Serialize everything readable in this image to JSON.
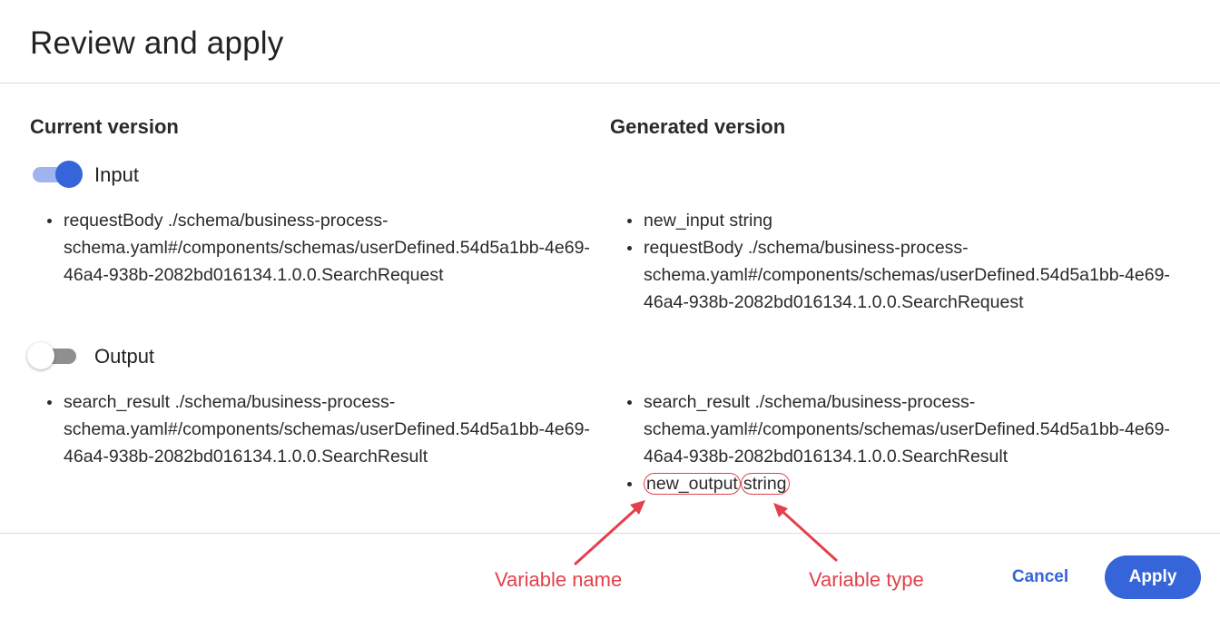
{
  "dialog": {
    "title": "Review and apply"
  },
  "current": {
    "heading": "Current version",
    "input_toggle": {
      "label": "Input",
      "on": true
    },
    "input_items": [
      "requestBody ./schema/business-process-schema.yaml#/components/schemas/userDefined.54d5a1bb-4e69-46a4-938b-2082bd016134.1.0.0.SearchRequest"
    ],
    "output_toggle": {
      "label": "Output",
      "on": false
    },
    "output_items": [
      "search_result ./schema/business-process-schema.yaml#/components/schemas/userDefined.54d5a1bb-4e69-46a4-938b-2082bd016134.1.0.0.SearchResult"
    ]
  },
  "generated": {
    "heading": "Generated version",
    "input_items": [
      "new_input string",
      "requestBody ./schema/business-process-schema.yaml#/components/schemas/userDefined.54d5a1bb-4e69-46a4-938b-2082bd016134.1.0.0.SearchRequest"
    ],
    "output_items": [
      "search_result ./schema/business-process-schema.yaml#/components/schemas/userDefined.54d5a1bb-4e69-46a4-938b-2082bd016134.1.0.0.SearchResult"
    ],
    "new_output": {
      "name": "new_output",
      "type": "string"
    }
  },
  "annotations": {
    "name_label": "Variable name",
    "type_label": "Variable type",
    "color": "#e3404b"
  },
  "footer": {
    "cancel_label": "Cancel",
    "apply_label": "Apply"
  },
  "colors": {
    "accent": "#3565d8",
    "toggle_on_track": "#9fb4ee",
    "toggle_off_track": "#8f8f8f"
  }
}
